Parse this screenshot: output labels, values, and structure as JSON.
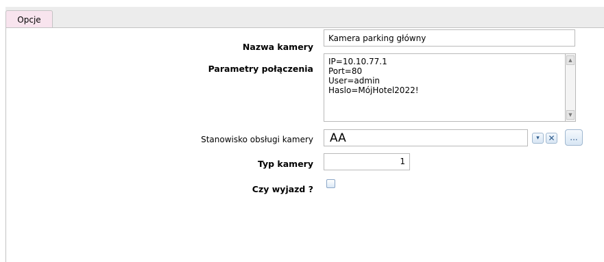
{
  "tabs": [
    {
      "label": "Opcje",
      "active": true
    }
  ],
  "form": {
    "camera_name_label": "Nazwa kamery",
    "camera_name_value": "Kamera parking główny",
    "connection_params_label": "Parametry połączenia",
    "connection_params_value": "IP=10.10.77.1\nPort=80\nUser=admin\nHaslo=MójHotel2022!",
    "station_label": "Stanowisko obsługi kamery",
    "station_value": "AA",
    "camera_type_label": "Typ kamery",
    "camera_type_value": "1",
    "exit_label": "Czy wyjazd ?",
    "exit_checked": false
  },
  "buttons": {
    "dropdown_glyph": "▾",
    "clear_glyph": "✕",
    "browse_label": "..."
  },
  "icons": {
    "scroll_up": "▲",
    "scroll_down": "▼"
  },
  "colors": {
    "tab_active_bg": "#f8e4ee",
    "tabstrip_bg": "#ececec",
    "field_border": "#b9b9b9",
    "button_accent": "#2c5a8c"
  }
}
